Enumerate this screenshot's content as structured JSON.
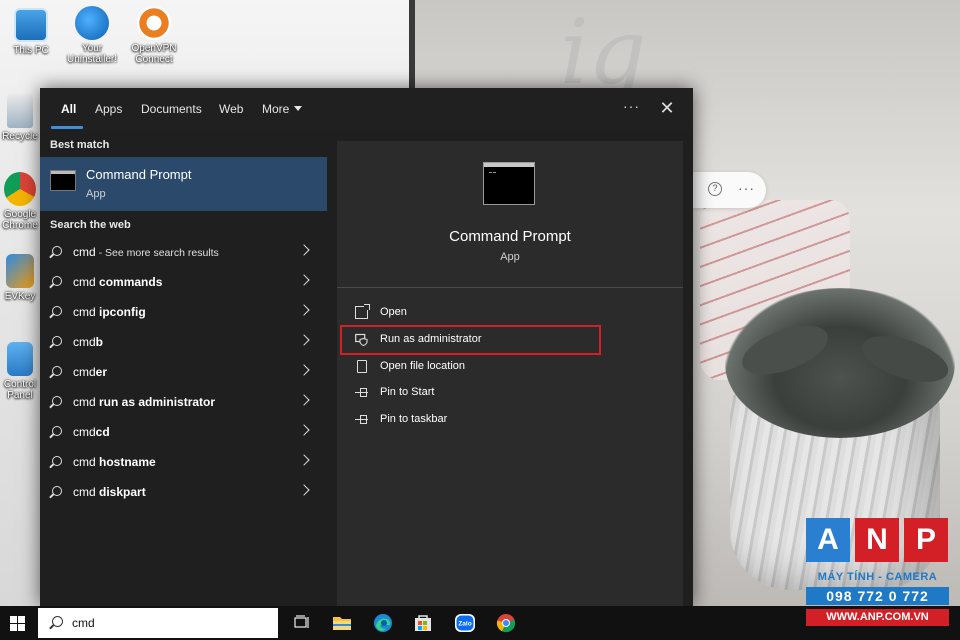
{
  "desktop": {
    "icons": [
      {
        "label": "This PC"
      },
      {
        "label": "Your Uninstaller!"
      },
      {
        "label": "OpenVPN Connect"
      },
      {
        "label": "Recycle"
      },
      {
        "label": "Google Chrome"
      },
      {
        "label": "EVKey"
      },
      {
        "label": "Control Panel"
      }
    ]
  },
  "tabs": [
    {
      "label": "All",
      "active": true
    },
    {
      "label": "Apps"
    },
    {
      "label": "Documents"
    },
    {
      "label": "Web"
    },
    {
      "label": "More"
    }
  ],
  "panel": {
    "more_options_icon": "ellipsis-icon",
    "close_icon": "close-icon",
    "ellipsis_text": "···",
    "close_text": "✕"
  },
  "best_match": {
    "heading": "Best match",
    "title": "Command Prompt",
    "subtitle": "App"
  },
  "web_search": {
    "heading": "Search the web",
    "results": [
      {
        "prefix": "cmd",
        "bold": "",
        "suffix": " - See more search results"
      },
      {
        "prefix": "cmd ",
        "bold": "commands",
        "suffix": ""
      },
      {
        "prefix": "cmd ",
        "bold": "ipconfig",
        "suffix": ""
      },
      {
        "prefix": "cmd",
        "bold": "b",
        "suffix": ""
      },
      {
        "prefix": "cmd",
        "bold": "er",
        "suffix": ""
      },
      {
        "prefix": "cmd ",
        "bold": "run as administrator",
        "suffix": ""
      },
      {
        "prefix": "cmd",
        "bold": "cd",
        "suffix": ""
      },
      {
        "prefix": "cmd ",
        "bold": "hostname",
        "suffix": ""
      },
      {
        "prefix": "cmd ",
        "bold": "diskpart",
        "suffix": ""
      }
    ]
  },
  "preview": {
    "title": "Command Prompt",
    "subtitle": "App",
    "actions": [
      {
        "label": "Open",
        "icon": "open-icon"
      },
      {
        "label": "Run as administrator",
        "icon": "shield-icon"
      },
      {
        "label": "Open file location",
        "icon": "folder-icon"
      },
      {
        "label": "Pin to Start",
        "icon": "pin-icon"
      },
      {
        "label": "Pin to taskbar",
        "icon": "pin-icon"
      }
    ]
  },
  "taskbar": {
    "search_value": "cmd",
    "apps": [
      "task-view-icon",
      "file-explorer-icon",
      "edge-icon",
      "store-icon",
      "zalo-icon",
      "chrome-icon"
    ]
  },
  "watermark": {
    "letters": [
      "A",
      "N",
      "P"
    ],
    "tagline": "MÁY TÍNH - CAMERA",
    "phone": "098 772 0 772",
    "url": "WWW.ANP.COM.VN"
  },
  "colors": {
    "highlight_red": "#d32027",
    "accent_blue": "#3d8fe0",
    "selected_row": "#2b4a6b",
    "panel_bg": "#1f1f1f",
    "preview_bg": "#2b2b2b"
  }
}
